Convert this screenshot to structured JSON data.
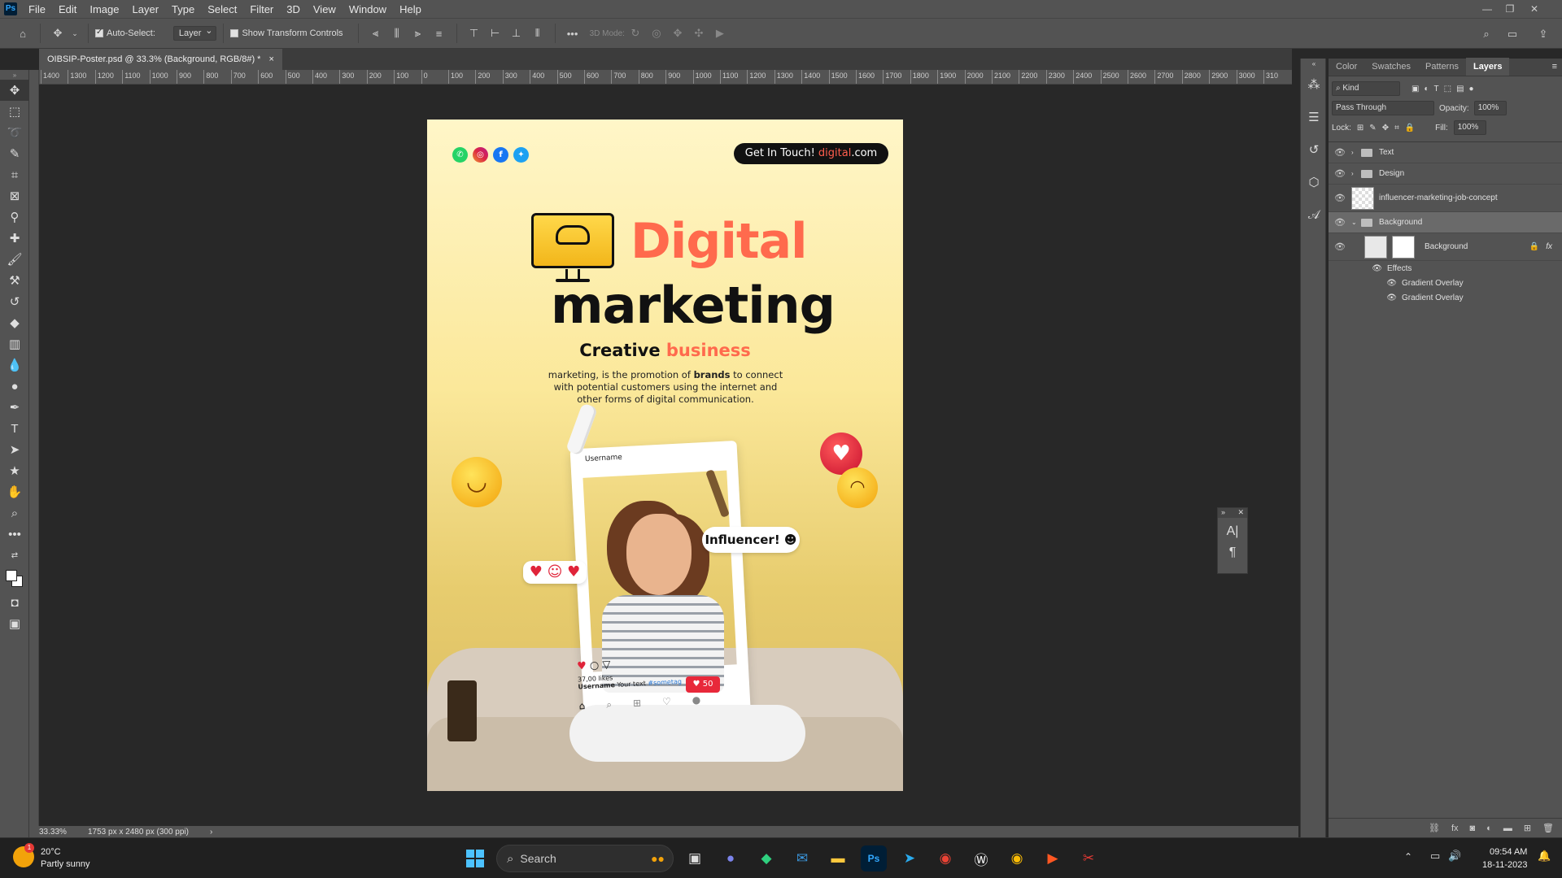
{
  "menubar": {
    "app_icon": "Ps",
    "items": [
      "File",
      "Edit",
      "Image",
      "Layer",
      "Type",
      "Select",
      "Filter",
      "3D",
      "View",
      "Window",
      "Help"
    ]
  },
  "options": {
    "auto_select_label": "Auto-Select:",
    "auto_select_value": "Layer",
    "transform_label": "Show Transform Controls",
    "mode_3d_label": "3D Mode:"
  },
  "document": {
    "tab_title": "OIBSIP-Poster.psd @ 33.3% (Background, RGB/8#) *",
    "tab_close": "×"
  },
  "ruler": {
    "h_ticks": [
      "1400",
      "1300",
      "1200",
      "1100",
      "1000",
      "900",
      "800",
      "700",
      "600",
      "500",
      "400",
      "300",
      "200",
      "100",
      "0",
      "100",
      "200",
      "300",
      "400",
      "500",
      "600",
      "700",
      "800",
      "900",
      "1000",
      "1100",
      "1200",
      "1300",
      "1400",
      "1500",
      "1600",
      "1700",
      "1800",
      "1900",
      "2000",
      "2100",
      "2200",
      "2300",
      "2400",
      "2500",
      "2600",
      "2700",
      "2800",
      "2900",
      "3000",
      "310"
    ]
  },
  "poster": {
    "git_label": "Get In Touch!",
    "git_domain_hl": "digital",
    "git_domain_rest": ".com",
    "title_1": "Digital",
    "title_2": "marketing",
    "subtitle_1": "Creative",
    "subtitle_2": "business",
    "desc_1": "marketing, is the promotion of",
    "desc_bold": "brands",
    "desc_2": "to connect with potential customers using the internet and other forms of digital communication.",
    "card_username": "Username",
    "bubble": "Influencer!",
    "likes": "37,00 likes",
    "post_user": "Username",
    "post_text": "Your text",
    "post_tag": "#sometag",
    "badge_count": "50"
  },
  "layers_panel": {
    "tabs": [
      "Color",
      "Swatches",
      "Patterns",
      "Layers"
    ],
    "active_tab": "Layers",
    "filter_kind": "Kind",
    "blend_mode": "Pass Through",
    "opacity_label": "Opacity:",
    "opacity_value": "100%",
    "lock_label": "Lock:",
    "fill_label": "Fill:",
    "fill_value": "100%",
    "layers": [
      {
        "name": "Text",
        "type": "group"
      },
      {
        "name": "Design",
        "type": "group"
      },
      {
        "name": "influencer-marketing-job-concept",
        "type": "image"
      },
      {
        "name": "Background",
        "type": "group",
        "selected": true
      },
      {
        "name": "Background",
        "type": "layer"
      }
    ],
    "effects_label": "Effects",
    "effects": [
      "Gradient Overlay",
      "Gradient Overlay"
    ],
    "fx_label": "fx"
  },
  "statusbar": {
    "zoom": "33.33%",
    "doc_size": "1753 px x 2480 px (300 ppi)"
  },
  "taskbar": {
    "weather_temp": "20°C",
    "weather_desc": "Partly sunny",
    "weather_badge": "1",
    "search_placeholder": "Search",
    "time": "09:54 AM",
    "date": "18-11-2023"
  }
}
